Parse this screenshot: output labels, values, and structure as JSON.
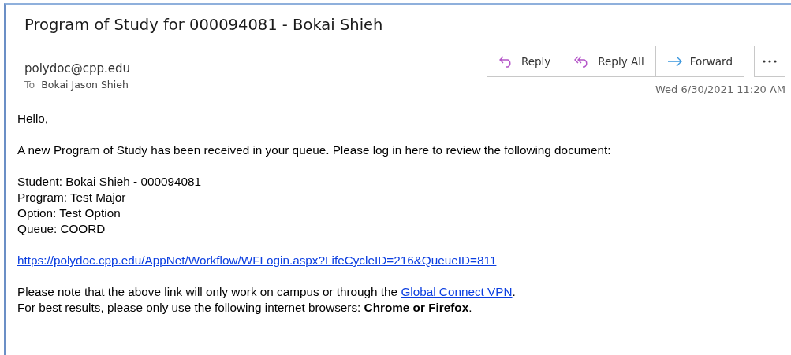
{
  "subject": "Program of Study for 000094081 - Bokai Shieh",
  "sender": "polydoc@cpp.edu",
  "to_label": "To",
  "recipient": "Bokai Jason Shieh",
  "actions": [
    {
      "kind": "reply",
      "label": "Reply"
    },
    {
      "kind": "reply_all",
      "label": "Reply All"
    },
    {
      "kind": "forward",
      "label": "Forward"
    }
  ],
  "more": {
    "kind": "more"
  },
  "date": "Wed 6/30/2021 11:20 AM",
  "body": [
    {
      "lines": [
        {
          "text": "Hello,"
        }
      ]
    },
    {
      "lines": [
        {
          "text": "A new Program of Study has been received in your queue. Please log in here to review the following document:"
        }
      ]
    },
    {
      "lines": [
        {
          "text": "Student: Bokai Shieh - 000094081"
        },
        {
          "text": "Program: Test Major"
        },
        {
          "text": "Option: Test Option"
        },
        {
          "text": "Queue: COORD"
        }
      ]
    },
    {
      "lines": [
        {
          "link": "https://polydoc.cpp.edu/AppNet/Workflow/WFLogin.aspx?LifeCycleID=216&QueueID=811"
        }
      ]
    },
    {
      "lines": [
        {
          "text": "Please note that the above link will only work on campus or through the ",
          "link": "Global Connect VPN",
          "after": "."
        },
        {
          "text": "For best results, please only use the following internet browsers: **Chrome or Firefox**."
        }
      ]
    }
  ]
}
